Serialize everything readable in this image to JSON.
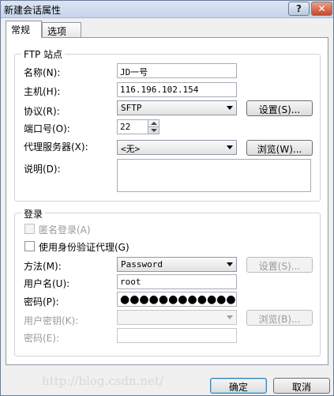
{
  "window": {
    "title": "新建会话属性",
    "help_glyph": "?",
    "close_glyph": "✕"
  },
  "tabs": [
    {
      "label": "常规"
    },
    {
      "label": "选项"
    }
  ],
  "ftp_site": {
    "group_title": "FTP 站点",
    "name_label": "名称(N):",
    "name_value": "JD一号",
    "host_label": "主机(H):",
    "host_value": "116.196.102.154",
    "protocol_label": "协议(R):",
    "protocol_value": "SFTP",
    "settings_button": "设置(S)...",
    "port_label": "端口号(O):",
    "port_value": "22",
    "proxy_label": "代理服务器(X):",
    "proxy_value": "<无>",
    "browse_button": "浏览(W)...",
    "desc_label": "说明(D):",
    "desc_value": ""
  },
  "login": {
    "group_title": "登录",
    "anonymous_label": "匿名登录(A)",
    "use_agent_label": "使用身份验证代理(G)",
    "method_label": "方法(M):",
    "method_value": "Password",
    "method_settings_button": "设置(S)...",
    "username_label": "用户名(U):",
    "username_value": "root",
    "password_label": "密码(P):",
    "password_value": "●●●●●●●●●●●●●●",
    "user_key_label": "用户密钥(K):",
    "user_key_value": "",
    "key_browse_button": "浏览(B)...",
    "passphrase_label": "密码(E):",
    "passphrase_value": ""
  },
  "footer": {
    "ok_button": "确定",
    "cancel_button": "取消"
  },
  "watermark": "http://blog.csdn.net/"
}
